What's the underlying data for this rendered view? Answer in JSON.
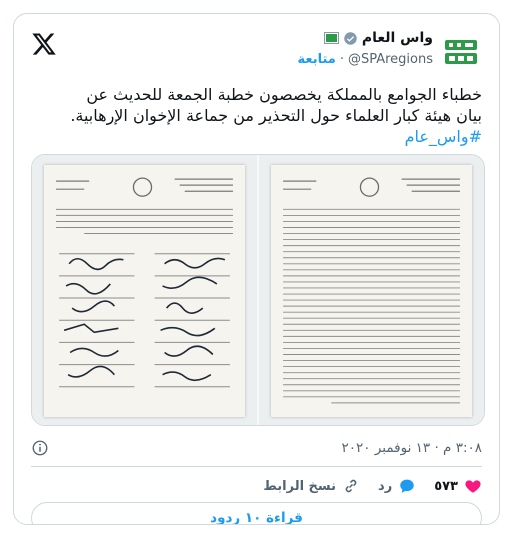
{
  "account": {
    "name": "واس العام",
    "handle": "@SPAregions",
    "follow_label": "متابعة",
    "dot": "·"
  },
  "tweet": {
    "text_line1": "خطباء الجوامع بالمملكة يخصصون خطبة الجمعة للحديث عن",
    "text_line2": "بيان هيئة كبار العلماء حول التحذير من جماعة الإخوان الإرهابية.",
    "hashtag": "#واس_عام"
  },
  "timestamp": "٣:٠٨ م · ١٣ نوفمبر ٢٠٢٠",
  "actions": {
    "like_count": "٥٧٣",
    "reply_label": "رد",
    "copy_link_label": "نسخ الرابط"
  },
  "read_replies_label": "قراءة ١٠ ردود",
  "colors": {
    "accent": "#1d9bf0",
    "like": "#f91880",
    "spa_green": "#2c9a46",
    "verified": "#829aab"
  }
}
